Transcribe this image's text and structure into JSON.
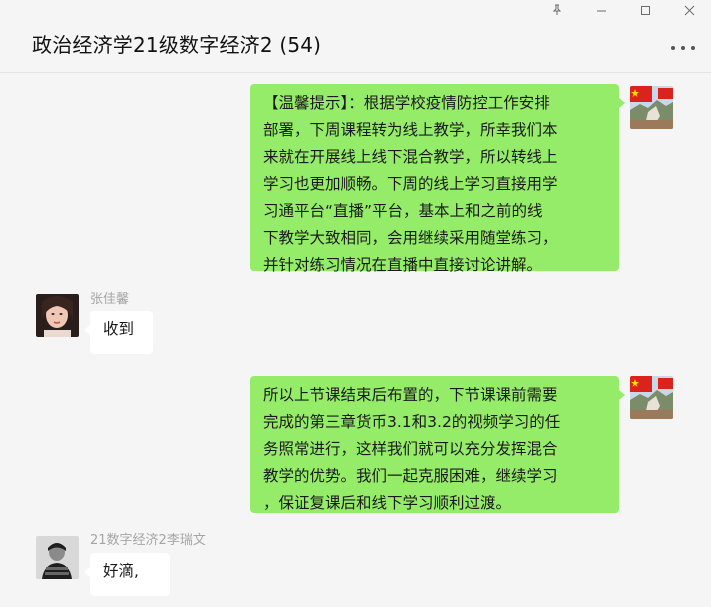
{
  "window": {
    "title": "政治经济学21级数字经济2 (54)",
    "controls": [
      "pin-icon",
      "minimize-icon",
      "maximize-icon",
      "close-icon"
    ],
    "more_icon": "more-dots-icon"
  },
  "colors": {
    "background": "#f5f5f5",
    "outgoing_bubble": "#95ec69",
    "incoming_bubble": "#ffffff",
    "sender_name": "#a5a5a5"
  },
  "messages": [
    {
      "direction": "outgoing",
      "lines": [
        "【温馨提示】：根据学校疫情防控工作安排",
        "部署，下周课程转为线上教学，所幸我们本",
        "来就在开展线上线下混合教学，所以转线上",
        "学习也更加顺畅。下周的线上学习直接用学",
        "习通平台“直播”平台，基本上和之前的线",
        "下教学大致相同，会用继续采用随堂练习，",
        "并针对练习情况在直播中直接讨论讲解。"
      ]
    },
    {
      "direction": "incoming",
      "sender": "张佳馨",
      "text": "收到"
    },
    {
      "direction": "outgoing",
      "lines": [
        "所以上节课结束后布置的，下节课课前需要",
        "完成的第三章货币3.1和3.2的视频学习的任",
        "务照常进行，这样我们就可以充分发挥混合",
        "教学的优势。我们一起克服困难，继续学习",
        "，保证复课后和线下学习顺利过渡。"
      ]
    },
    {
      "direction": "incoming",
      "sender": "21数字经济2李瑞文",
      "text": "好滴,"
    }
  ]
}
